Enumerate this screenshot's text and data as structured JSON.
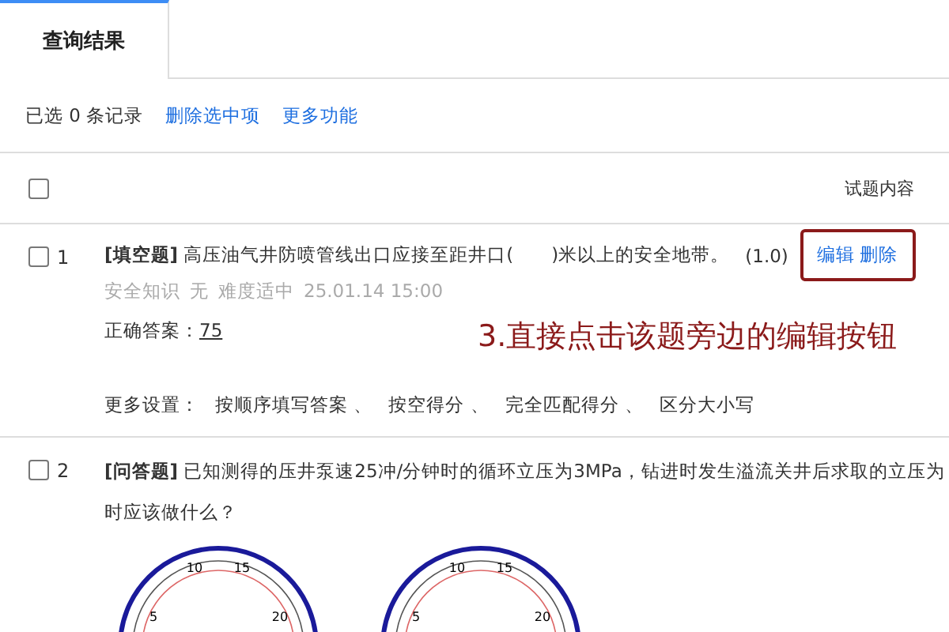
{
  "tabs": [
    {
      "label": "查询结果",
      "selected": true
    }
  ],
  "toolbar": {
    "selection_count": "已选 0 条记录",
    "links": [
      "删除选中项",
      "更多功能"
    ]
  },
  "table": {
    "select_all_checked": false,
    "column_header": "试题内容",
    "rows": [
      {
        "kind": "fill",
        "checked": false,
        "number": "1",
        "question": "**[填空题]** 高压油气井防喷管线出口应接至距井口(　　)米以上的安全地带。",
        "score": "(1.0)",
        "actions": [
          "编辑",
          "删除"
        ],
        "meta": [
          "安全知识",
          "无",
          "难度适中",
          "25.01.14 15:00"
        ],
        "answer_label": "正确答案：",
        "answer": "75",
        "settings_label": "更多设置：",
        "settings": [
          "按顺序填写答案 、",
          "按空得分 、",
          "完全匹配得分 、",
          "区分大小写"
        ]
      },
      {
        "kind": "essay",
        "checked": false,
        "number": "2",
        "question_lines": [
          "**[问答题]** 已知测得的压井泵速25冲/分钟时的循环立压为3MPa，钻进时发生溢流关井后求取的立压为",
          "时应该做什么？"
        ],
        "gauges": [
          {
            "labels": [
              "10",
              "15",
              "5",
              "20"
            ]
          },
          {
            "labels": [
              "10",
              "15",
              "5",
              "20"
            ]
          }
        ]
      }
    ]
  },
  "annotation": {
    "text": "3.直接点击该题旁边的编辑按钮"
  }
}
